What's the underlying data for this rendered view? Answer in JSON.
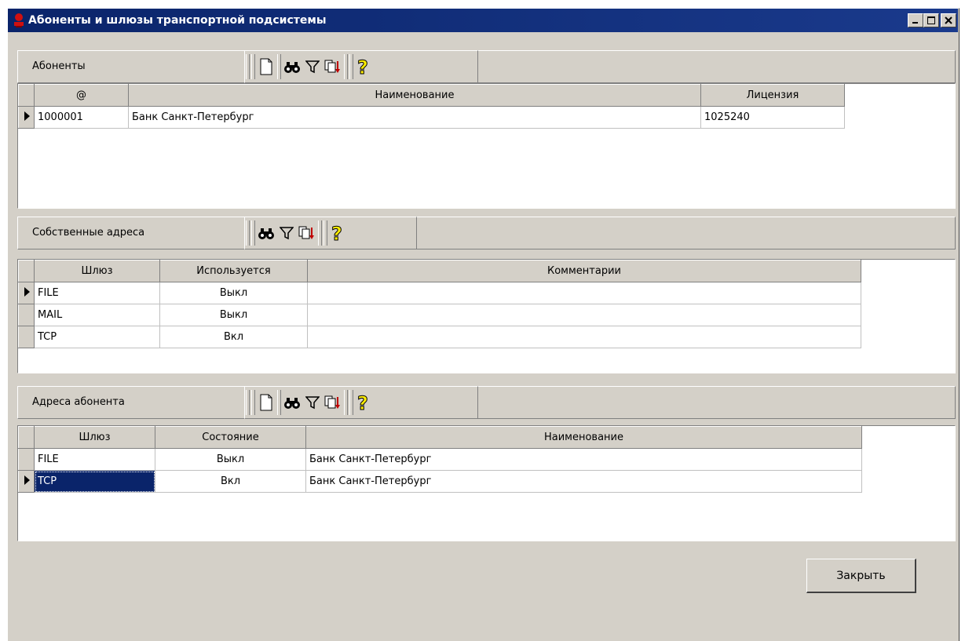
{
  "window": {
    "title": "Абоненты и шлюзы транспортной подсистемы"
  },
  "subscribers": {
    "label": "Абоненты",
    "columns": [
      "@",
      "Наименование",
      "Лицензия"
    ],
    "rows": [
      {
        "id": "1000001",
        "name": "Банк Санкт-Петербург",
        "license": "1025240"
      }
    ]
  },
  "own_addresses": {
    "label": "Собственные адреса",
    "columns": [
      "Шлюз",
      "Используется",
      "Комментарии"
    ],
    "rows": [
      {
        "gateway": "FILE",
        "used": "Выкл",
        "comment": ""
      },
      {
        "gateway": "MAIL",
        "used": "Выкл",
        "comment": ""
      },
      {
        "gateway": "TCP",
        "used": "Вкл",
        "comment": ""
      }
    ]
  },
  "subscriber_addresses": {
    "label": "Адреса абонента",
    "columns": [
      "Шлюз",
      "Состояние",
      "Наименование"
    ],
    "rows": [
      {
        "gateway": "FILE",
        "state": "Выкл",
        "name": "Банк Санкт-Петербург"
      },
      {
        "gateway": "TCP",
        "state": "Вкл",
        "name": "Банк Санкт-Петербург"
      }
    ]
  },
  "buttons": {
    "close": "Закрыть"
  },
  "icons": {
    "new": "new-document-icon",
    "find": "binoculars-icon",
    "filter": "filter-icon",
    "export": "export-icon",
    "help": "help-icon"
  }
}
